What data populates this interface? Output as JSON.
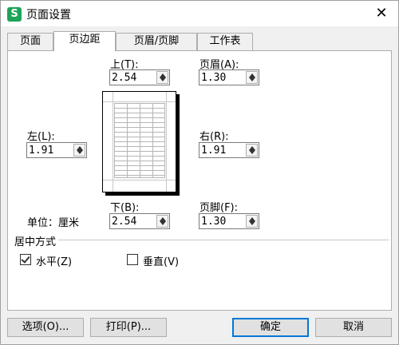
{
  "window": {
    "title": "页面设置",
    "app_icon_letter": "S",
    "close_symbol": "✕"
  },
  "tabs": [
    {
      "label": "页面",
      "active": false
    },
    {
      "label": "页边距",
      "active": true
    },
    {
      "label": "页眉/页脚",
      "active": false
    },
    {
      "label": "工作表",
      "active": false
    }
  ],
  "margins": {
    "top": {
      "label": "上(T):",
      "value": "2.54"
    },
    "header": {
      "label": "页眉(A):",
      "value": "1.30"
    },
    "left": {
      "label": "左(L):",
      "value": "1.91"
    },
    "right": {
      "label": "右(R):",
      "value": "1.91"
    },
    "bottom": {
      "label": "下(B):",
      "value": "2.54"
    },
    "footer": {
      "label": "页脚(F):",
      "value": "1.30"
    }
  },
  "unit_label": "单位：厘米",
  "center": {
    "group_label": "居中方式",
    "horizontal": {
      "label": "水平(Z)",
      "checked": true
    },
    "vertical": {
      "label": "垂直(V)",
      "checked": false
    }
  },
  "buttons": {
    "options": "选项(O)...",
    "print": "打印(P)...",
    "ok": "确定",
    "cancel": "取消"
  },
  "colors": {
    "accent": "#0078d7",
    "app_icon": "#1da35a"
  }
}
